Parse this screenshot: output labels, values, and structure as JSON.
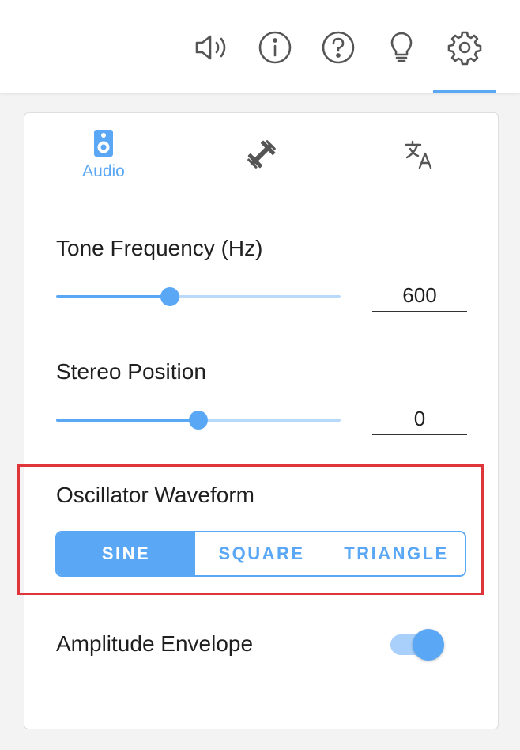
{
  "toolbar": {
    "icons": [
      "sound-icon",
      "info-icon",
      "help-icon",
      "lightbulb-icon",
      "gear-icon"
    ],
    "active": "gear-icon"
  },
  "tabs": [
    {
      "label": "Audio",
      "icon": "speaker-icon",
      "active": true
    },
    {
      "label": "",
      "icon": "dumbbell-icon",
      "active": false
    },
    {
      "label": "",
      "icon": "translate-icon",
      "active": false
    }
  ],
  "tone_frequency": {
    "label": "Tone Frequency (Hz)",
    "value": "600",
    "slider_fraction": 0.4
  },
  "stereo_position": {
    "label": "Stereo Position",
    "value": "0",
    "slider_fraction": 0.5
  },
  "oscillator": {
    "label": "Oscillator Waveform",
    "options": [
      "SINE",
      "SQUARE",
      "TRIANGLE"
    ],
    "selected": "SINE"
  },
  "amplitude_envelope": {
    "label": "Amplitude Envelope",
    "enabled": true
  },
  "colors": {
    "accent": "#5aa7f5",
    "highlight": "#e0343b"
  }
}
